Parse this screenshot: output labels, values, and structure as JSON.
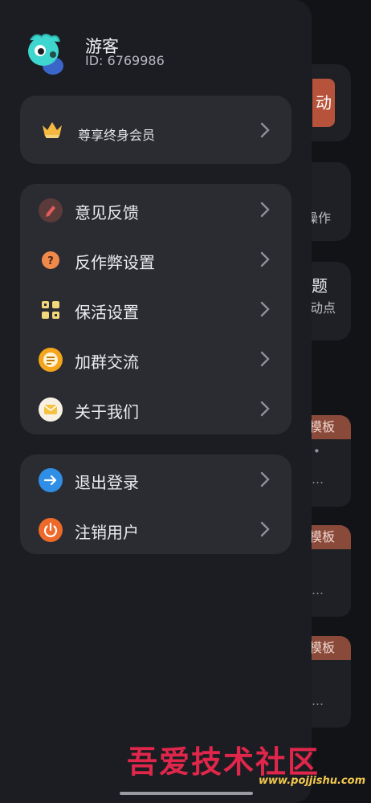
{
  "background": {
    "button_label": "动",
    "card1_text": "操作",
    "card2_title": "题",
    "card2_sub": "动点",
    "template_label": "模板",
    "template_dots": [
      "•",
      "…",
      "…",
      "…"
    ]
  },
  "user": {
    "name": "游客",
    "id": "ID: 6769986"
  },
  "vip": {
    "label": "尊享终身会员"
  },
  "menu": [
    {
      "label": "意见反馈",
      "icon": "feedback-icon",
      "color": "#5b3a3a"
    },
    {
      "label": "反作弊设置",
      "icon": "anti-cheat-icon",
      "color": "#f08a4b"
    },
    {
      "label": "保活设置",
      "icon": "keep-alive-icon",
      "color": "#f2d77b"
    },
    {
      "label": "加群交流",
      "icon": "group-chat-icon",
      "color": "#f4a51c"
    },
    {
      "label": "关于我们",
      "icon": "mail-icon",
      "color": "#f7f1e3"
    }
  ],
  "account": [
    {
      "label": "退出登录",
      "icon": "logout-icon",
      "color": "#2f8fe6"
    },
    {
      "label": "注销用户",
      "icon": "power-icon",
      "color": "#ee6a2b"
    }
  ],
  "watermark": {
    "text": "吾爱技术社区",
    "url": "www.pojjishu.com"
  }
}
